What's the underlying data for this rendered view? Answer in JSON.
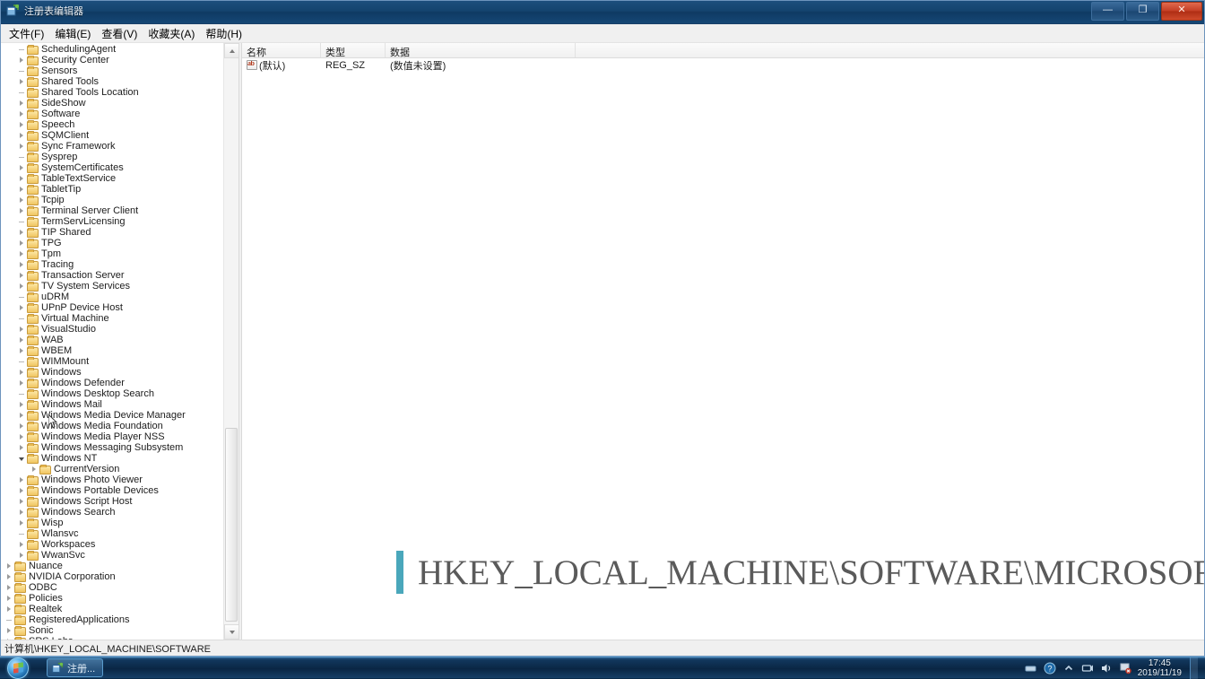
{
  "window": {
    "title": "注册表编辑器",
    "icon": "regedit-icon",
    "minimize_label": "—",
    "maximize_label": "❐",
    "close_label": "✕"
  },
  "menubar": {
    "items": [
      {
        "label": "文件(F)"
      },
      {
        "label": "编辑(E)"
      },
      {
        "label": "查看(V)"
      },
      {
        "label": "收藏夹(A)"
      },
      {
        "label": "帮助(H)"
      }
    ]
  },
  "tree": {
    "items": [
      {
        "label": "SchedulingAgent",
        "indent": 1,
        "state": "leaf"
      },
      {
        "label": "Security Center",
        "indent": 1,
        "state": "collapsed"
      },
      {
        "label": "Sensors",
        "indent": 1,
        "state": "leaf"
      },
      {
        "label": "Shared Tools",
        "indent": 1,
        "state": "collapsed"
      },
      {
        "label": "Shared Tools Location",
        "indent": 1,
        "state": "leaf"
      },
      {
        "label": "SideShow",
        "indent": 1,
        "state": "collapsed"
      },
      {
        "label": "Software",
        "indent": 1,
        "state": "collapsed"
      },
      {
        "label": "Speech",
        "indent": 1,
        "state": "collapsed"
      },
      {
        "label": "SQMClient",
        "indent": 1,
        "state": "collapsed"
      },
      {
        "label": "Sync Framework",
        "indent": 1,
        "state": "collapsed"
      },
      {
        "label": "Sysprep",
        "indent": 1,
        "state": "leaf"
      },
      {
        "label": "SystemCertificates",
        "indent": 1,
        "state": "collapsed"
      },
      {
        "label": "TableTextService",
        "indent": 1,
        "state": "collapsed"
      },
      {
        "label": "TabletTip",
        "indent": 1,
        "state": "collapsed"
      },
      {
        "label": "Tcpip",
        "indent": 1,
        "state": "collapsed"
      },
      {
        "label": "Terminal Server Client",
        "indent": 1,
        "state": "collapsed"
      },
      {
        "label": "TermServLicensing",
        "indent": 1,
        "state": "leaf"
      },
      {
        "label": "TIP Shared",
        "indent": 1,
        "state": "collapsed"
      },
      {
        "label": "TPG",
        "indent": 1,
        "state": "collapsed"
      },
      {
        "label": "Tpm",
        "indent": 1,
        "state": "collapsed"
      },
      {
        "label": "Tracing",
        "indent": 1,
        "state": "collapsed"
      },
      {
        "label": "Transaction Server",
        "indent": 1,
        "state": "collapsed"
      },
      {
        "label": "TV System Services",
        "indent": 1,
        "state": "collapsed"
      },
      {
        "label": "uDRM",
        "indent": 1,
        "state": "leaf"
      },
      {
        "label": "UPnP Device Host",
        "indent": 1,
        "state": "collapsed"
      },
      {
        "label": "Virtual Machine",
        "indent": 1,
        "state": "leaf"
      },
      {
        "label": "VisualStudio",
        "indent": 1,
        "state": "collapsed"
      },
      {
        "label": "WAB",
        "indent": 1,
        "state": "collapsed"
      },
      {
        "label": "WBEM",
        "indent": 1,
        "state": "collapsed"
      },
      {
        "label": "WIMMount",
        "indent": 1,
        "state": "leaf"
      },
      {
        "label": "Windows",
        "indent": 1,
        "state": "collapsed"
      },
      {
        "label": "Windows Defender",
        "indent": 1,
        "state": "collapsed"
      },
      {
        "label": "Windows Desktop Search",
        "indent": 1,
        "state": "leaf"
      },
      {
        "label": "Windows Mail",
        "indent": 1,
        "state": "collapsed"
      },
      {
        "label": "Windows Media Device Manager",
        "indent": 1,
        "state": "collapsed"
      },
      {
        "label": "Windows Media Foundation",
        "indent": 1,
        "state": "collapsed"
      },
      {
        "label": "Windows Media Player NSS",
        "indent": 1,
        "state": "collapsed"
      },
      {
        "label": "Windows Messaging Subsystem",
        "indent": 1,
        "state": "collapsed"
      },
      {
        "label": "Windows NT",
        "indent": 1,
        "state": "expanded"
      },
      {
        "label": "CurrentVersion",
        "indent": 2,
        "state": "collapsed"
      },
      {
        "label": "Windows Photo Viewer",
        "indent": 1,
        "state": "collapsed"
      },
      {
        "label": "Windows Portable Devices",
        "indent": 1,
        "state": "collapsed"
      },
      {
        "label": "Windows Script Host",
        "indent": 1,
        "state": "collapsed"
      },
      {
        "label": "Windows Search",
        "indent": 1,
        "state": "collapsed"
      },
      {
        "label": "Wisp",
        "indent": 1,
        "state": "collapsed"
      },
      {
        "label": "Wlansvc",
        "indent": 1,
        "state": "leaf"
      },
      {
        "label": "Workspaces",
        "indent": 1,
        "state": "collapsed"
      },
      {
        "label": "WwanSvc",
        "indent": 1,
        "state": "collapsed"
      },
      {
        "label": "Nuance",
        "indent": 0,
        "state": "collapsed"
      },
      {
        "label": "NVIDIA Corporation",
        "indent": 0,
        "state": "collapsed"
      },
      {
        "label": "ODBC",
        "indent": 0,
        "state": "collapsed"
      },
      {
        "label": "Policies",
        "indent": 0,
        "state": "collapsed"
      },
      {
        "label": "Realtek",
        "indent": 0,
        "state": "collapsed"
      },
      {
        "label": "RegisteredApplications",
        "indent": 0,
        "state": "leaf"
      },
      {
        "label": "Sonic",
        "indent": 0,
        "state": "collapsed"
      },
      {
        "label": "SRS Labs",
        "indent": 0,
        "state": "collapsed"
      }
    ]
  },
  "values": {
    "columns": [
      "名称",
      "类型",
      "数据",
      ""
    ],
    "rows": [
      {
        "name": "(默认)",
        "type": "REG_SZ",
        "data": "(数值未设置)",
        "icon": "string-value-icon"
      }
    ]
  },
  "annotation": {
    "text": "HKEY_LOCAL_MACHINE\\SOFTWARE\\MICROSOFT\\WINDOWS\\CURRENTVERSION\\EXPLORER",
    "bar_color": "#4aa7bb",
    "text_color": "#5a5a5a"
  },
  "statusbar": {
    "path": "计算机\\HKEY_LOCAL_MACHINE\\SOFTWARE"
  },
  "taskbar": {
    "start_label": "开始",
    "buttons": [
      {
        "label": "注册...",
        "icon": "regedit-icon"
      }
    ],
    "tray": {
      "icons": [
        "action-center-icon",
        "network-icon",
        "volume-icon",
        "flag-icon"
      ],
      "time": "17:45",
      "date": "2019/11/19"
    }
  }
}
